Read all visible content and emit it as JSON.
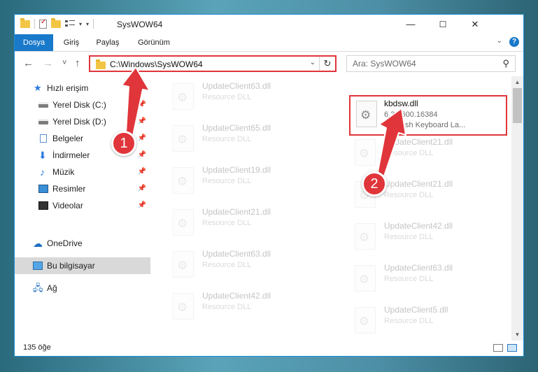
{
  "window": {
    "title": "SysWOW64",
    "minimize_symbol": "—",
    "maximize_symbol": "☐",
    "close_symbol": "✕"
  },
  "ribbon": {
    "tabs": [
      "Dosya",
      "Giriş",
      "Paylaş",
      "Görünüm"
    ],
    "help_symbol": "?"
  },
  "navigation": {
    "back_symbol": "←",
    "forward_symbol": "→",
    "recent_symbol": "˅",
    "up_symbol": "↑",
    "address": "C:\\Windows\\SysWOW64",
    "refresh_symbol": "↻",
    "search_placeholder": "Ara: SysWOW64"
  },
  "sidebar": {
    "items": [
      {
        "label": "Hızlı erişim",
        "icon": "star-icon"
      },
      {
        "label": "Yerel Disk (C:)",
        "icon": "drive-icon"
      },
      {
        "label": "Yerel Disk (D:)",
        "icon": "drive-icon"
      },
      {
        "label": "Belgeler",
        "icon": "documents-icon"
      },
      {
        "label": "İndirmeler",
        "icon": "download-icon"
      },
      {
        "label": "Müzik",
        "icon": "music-icon"
      },
      {
        "label": "Resimler",
        "icon": "pictures-icon"
      },
      {
        "label": "Videolar",
        "icon": "video-icon"
      },
      {
        "label": "OneDrive",
        "icon": "onedrive-icon"
      },
      {
        "label": "Bu bilgisayar",
        "icon": "computer-icon"
      },
      {
        "label": "Ağ",
        "icon": "network-icon"
      }
    ]
  },
  "files": {
    "left": [
      {
        "name": "UpdateClient63.dll",
        "type": "Resource DLL"
      },
      {
        "name": "UpdateClient65.dll",
        "type": "Resource DLL"
      },
      {
        "name": "UpdateClient19.dll",
        "type": "Resource DLL"
      },
      {
        "name": "UpdateClient21.dll",
        "type": "Resource DLL"
      },
      {
        "name": "UpdateClient63.dll",
        "type": "Resource DLL"
      },
      {
        "name": "UpdateClient42.dll",
        "type": "Resource DLL"
      }
    ],
    "right": [
      {
        "name": "kbdsw.dll",
        "version": "6.3.9600.16384",
        "description": "Swedish Keyboard La..."
      },
      {
        "name": "UpdateClient21.dll",
        "type": "Resource DLL"
      },
      {
        "name": "UpdateClient21.dll",
        "type": "Resource DLL"
      },
      {
        "name": "UpdateClient42.dll",
        "type": "Resource DLL"
      },
      {
        "name": "UpdateClient63.dll",
        "type": "Resource DLL"
      },
      {
        "name": "UpdateClient5.dll",
        "type": "Resource DLL"
      }
    ]
  },
  "status": {
    "item_count": "135 öğe"
  },
  "annotations": {
    "step1": "1",
    "step2": "2",
    "color": "#e0353a"
  }
}
